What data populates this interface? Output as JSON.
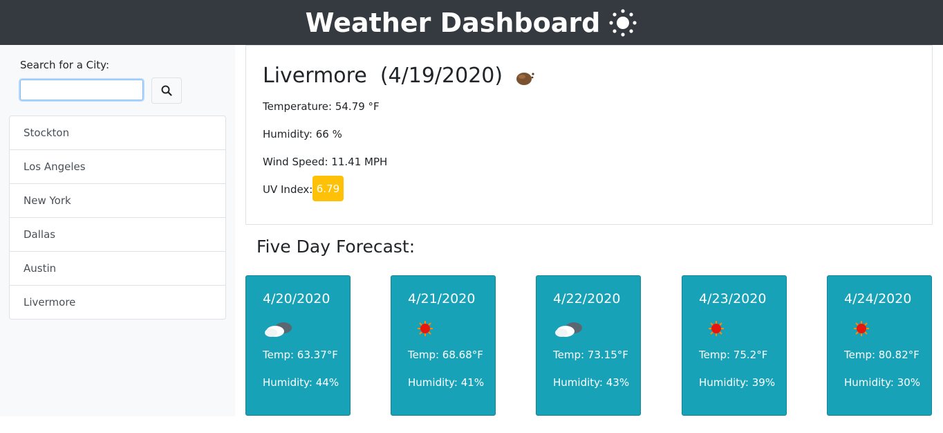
{
  "header": {
    "title": "Weather Dashboard",
    "icon": "sun-icon"
  },
  "search": {
    "label": "Search for a City:",
    "value": "",
    "placeholder": "",
    "button_icon": "search-icon"
  },
  "cities": [
    "Stockton",
    "Los Angeles",
    "New York",
    "Dallas",
    "Austin",
    "Livermore"
  ],
  "current": {
    "title": "Livermore  (4/19/2020)",
    "icon": "cloud-night-icon",
    "temperature": "Temperature: 54.79 °F",
    "humidity": "Humidity: 66 %",
    "wind": "Wind Speed: 11.41 MPH",
    "uv_label": "UV Index:",
    "uv_value": "6.79",
    "uv_color": "#ffc107"
  },
  "forecast_heading": "Five Day Forecast:",
  "forecast": [
    {
      "date": "4/20/2020",
      "icon": "partly-cloudy-icon",
      "temp": "Temp: 63.37°F",
      "humidity": "Humidity: 44%"
    },
    {
      "date": "4/21/2020",
      "icon": "sun-icon",
      "temp": "Temp: 68.68°F",
      "humidity": "Humidity: 41%"
    },
    {
      "date": "4/22/2020",
      "icon": "partly-cloudy-icon",
      "temp": "Temp: 73.15°F",
      "humidity": "Humidity: 43%"
    },
    {
      "date": "4/23/2020",
      "icon": "sun-icon",
      "temp": "Temp: 75.2°F",
      "humidity": "Humidity: 39%"
    },
    {
      "date": "4/24/2020",
      "icon": "sun-icon",
      "temp": "Temp: 80.82°F",
      "humidity": "Humidity: 30%"
    }
  ],
  "colors": {
    "header_bg": "#343a40",
    "card_bg": "#17a2b8",
    "uv_badge": "#ffc107",
    "sidebar_bg": "#f8f9fa"
  }
}
